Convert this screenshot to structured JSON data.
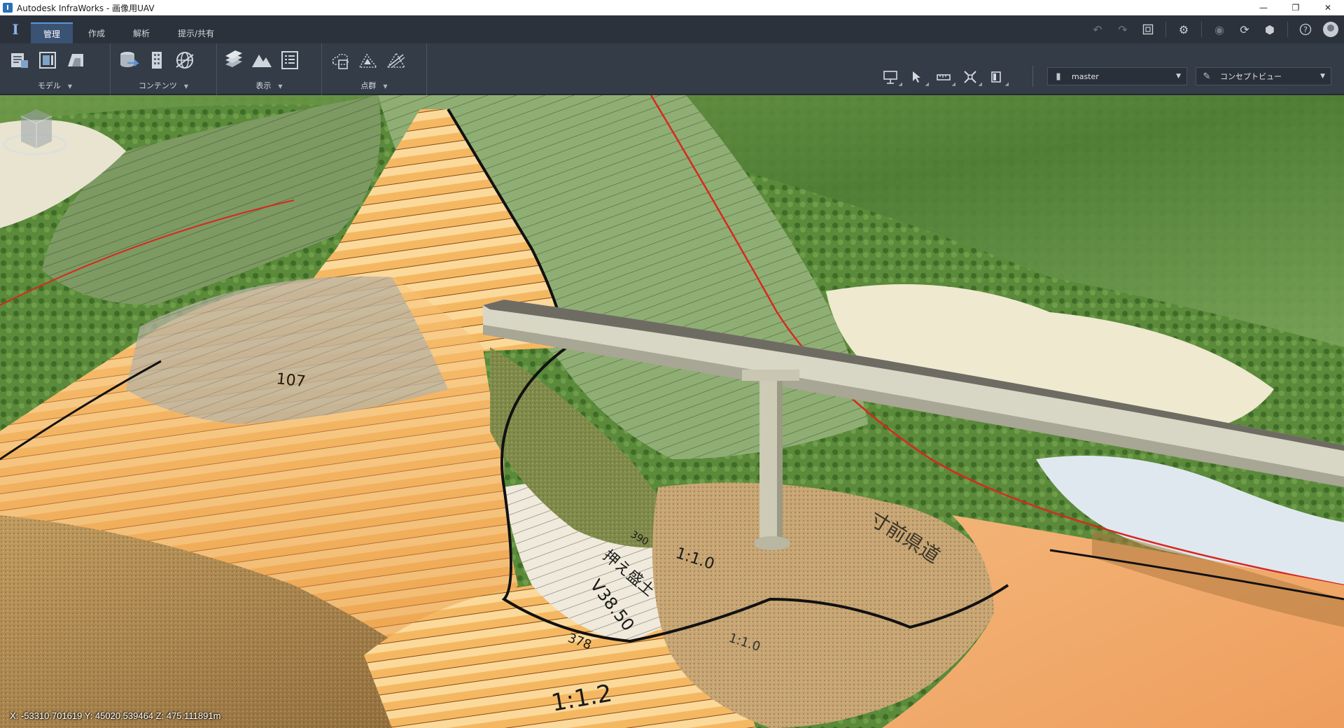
{
  "window": {
    "title": "Autodesk InfraWorks - 画像用UAV",
    "app_icon_letter": "I",
    "controls": {
      "minimize": "—",
      "restore": "❐",
      "close": "✕"
    }
  },
  "tabs": [
    {
      "label": "管理",
      "active": true
    },
    {
      "label": "作成",
      "active": false
    },
    {
      "label": "解析",
      "active": false
    },
    {
      "label": "提示/共有",
      "active": false
    }
  ],
  "header_icons": [
    "undo-icon",
    "redo-icon",
    "fit-view-icon",
    "settings-gear-icon",
    "globe-icon",
    "sync-icon",
    "cloud-3d-icon",
    "help-icon",
    "user-avatar-icon"
  ],
  "ribbon": {
    "groups": [
      {
        "label": "モデル",
        "icons": [
          "model-properties-icon",
          "model-layout-icon",
          "model-surface-icon"
        ]
      },
      {
        "label": "コンテンツ",
        "icons": [
          "data-sources-icon",
          "building-icon",
          "network-globe-icon"
        ]
      },
      {
        "label": "表示",
        "icons": [
          "layers-icon",
          "terrain-icon",
          "list-icon"
        ]
      },
      {
        "label": "点群",
        "icons": [
          "point-cloud-icon",
          "point-cloud-terrain-icon",
          "point-cloud-pattern-icon"
        ]
      }
    ],
    "tools": [
      "presentation-icon",
      "select-arrow-icon",
      "measure-icon",
      "crossing-icon",
      "panel-icon"
    ],
    "proposal_dropdown": {
      "value": "master"
    },
    "view_dropdown": {
      "value": "コンセプトビュー"
    }
  },
  "status": {
    "coordinates": "X: -53310.701619 Y: 45020.539464 Z: 475.111891m"
  },
  "map_labels": {
    "label_1": "1:1.0",
    "label_2": "1:1.2",
    "label_3": "378",
    "label_4": "390",
    "label_5": "107",
    "label_6": "押え盛土",
    "label_7": "V38.50",
    "label_8": "1:1.0",
    "label_9": "寸前県道"
  },
  "colors": {
    "accent": "#5b95d6",
    "tab_active": "#3a5273",
    "ribbon_bg": "#343c47",
    "terrain_orange": "#f0a24a",
    "vegetation": "#5f8a3c",
    "bridge": "#d8d6c4"
  }
}
